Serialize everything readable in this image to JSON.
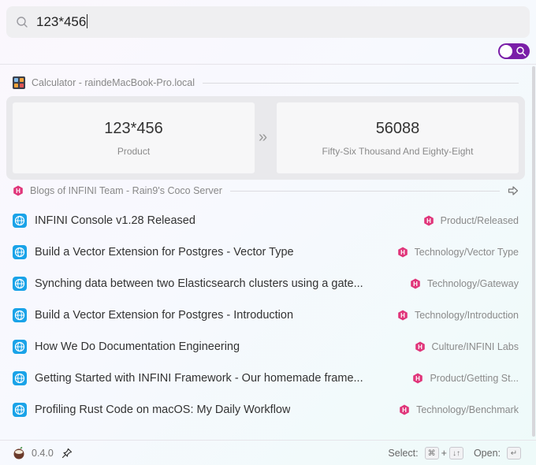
{
  "search": {
    "value": "123*456",
    "icon": "search-icon"
  },
  "toggle": {
    "accent": "#7a1ea8",
    "icon": "search-icon",
    "on": true
  },
  "calculator": {
    "section_title": "Calculator - raindeMacBook-Pro.local",
    "expression": "123*456",
    "expression_label": "Product",
    "result": "56088",
    "result_words": "Fifty-Six Thousand And Eighty-Eight",
    "arrow": "»"
  },
  "blogs": {
    "section_title": "Blogs of INFINI Team - Rain9's Coco Server",
    "items": [
      {
        "title": "INFINI Console v1.28 Released",
        "category": "Product/Released"
      },
      {
        "title": "Build a Vector Extension for Postgres - Vector Type",
        "category": "Technology/Vector Type"
      },
      {
        "title": "Synching data between two Elasticsearch clusters using a gate...",
        "category": "Technology/Gateway"
      },
      {
        "title": "Build a Vector Extension for Postgres - Introduction",
        "category": "Technology/Introduction"
      },
      {
        "title": "How We Do Documentation Engineering",
        "category": "Culture/INFINI Labs"
      },
      {
        "title": "Getting Started with INFINI Framework - Our homemade frame...",
        "category": "Product/Getting St..."
      },
      {
        "title": "Profiling Rust Code on macOS: My Daily Workflow",
        "category": "Technology/Benchmark"
      }
    ]
  },
  "footer": {
    "version": "0.4.0",
    "select_label": "Select:",
    "select_key1": "⌘",
    "select_plus": "+",
    "select_key2": "↓↑",
    "open_label": "Open:",
    "open_key": "↵"
  },
  "colors": {
    "brand_pink": "#e0357a",
    "globe_blue": "#1aa3e8"
  }
}
